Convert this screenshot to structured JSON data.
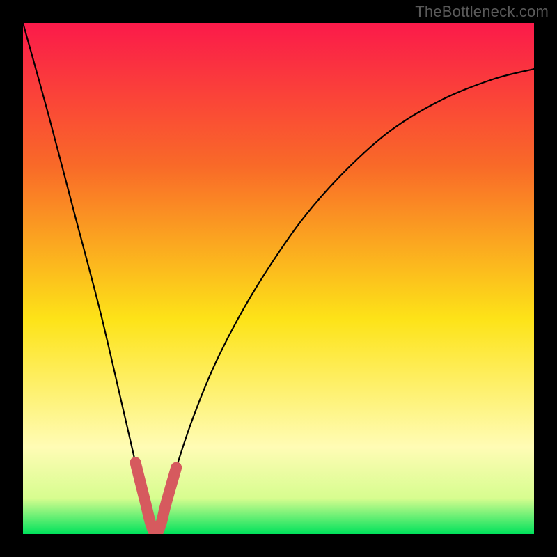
{
  "watermark": "TheBottleneck.com",
  "colors": {
    "background": "#000000",
    "gradient_top": "#fb1a4a",
    "gradient_mid_upper": "#f96a28",
    "gradient_mid": "#fde318",
    "gradient_lower": "#fffcb5",
    "gradient_band": "#d7fd8f",
    "gradient_bottom": "#00e25c",
    "curve": "#000000",
    "thick_curve": "#d65a5e",
    "watermark_text": "#5a5a5a"
  },
  "chart_data": {
    "type": "line",
    "title": "",
    "xlabel": "",
    "ylabel": "",
    "x_range": [
      0,
      100
    ],
    "y_range": [
      0,
      100
    ],
    "description": "Bottleneck V-curve: y approaches 0 at the optimum (~x=26) and rises steeply on either side. No numeric axes are shown.",
    "series": [
      {
        "name": "bottleneck_percent",
        "x": [
          0,
          5,
          10,
          15,
          19,
          22,
          24,
          25,
          26,
          27,
          28,
          30,
          33,
          37,
          42,
          48,
          55,
          63,
          72,
          82,
          92,
          100
        ],
        "y": [
          100,
          82,
          63,
          44,
          27,
          14,
          6,
          2,
          0,
          2,
          6,
          13,
          22,
          32,
          42,
          52,
          62,
          71,
          79,
          85,
          89,
          91
        ]
      },
      {
        "name": "highlighted_range",
        "x": [
          22,
          24,
          25,
          26,
          27,
          28,
          30
        ],
        "y": [
          14,
          6,
          2,
          0,
          2,
          6,
          13
        ]
      }
    ],
    "optimum_x": 26,
    "gradient_bands_y": [
      0,
      3,
      5,
      8,
      60,
      100
    ]
  }
}
